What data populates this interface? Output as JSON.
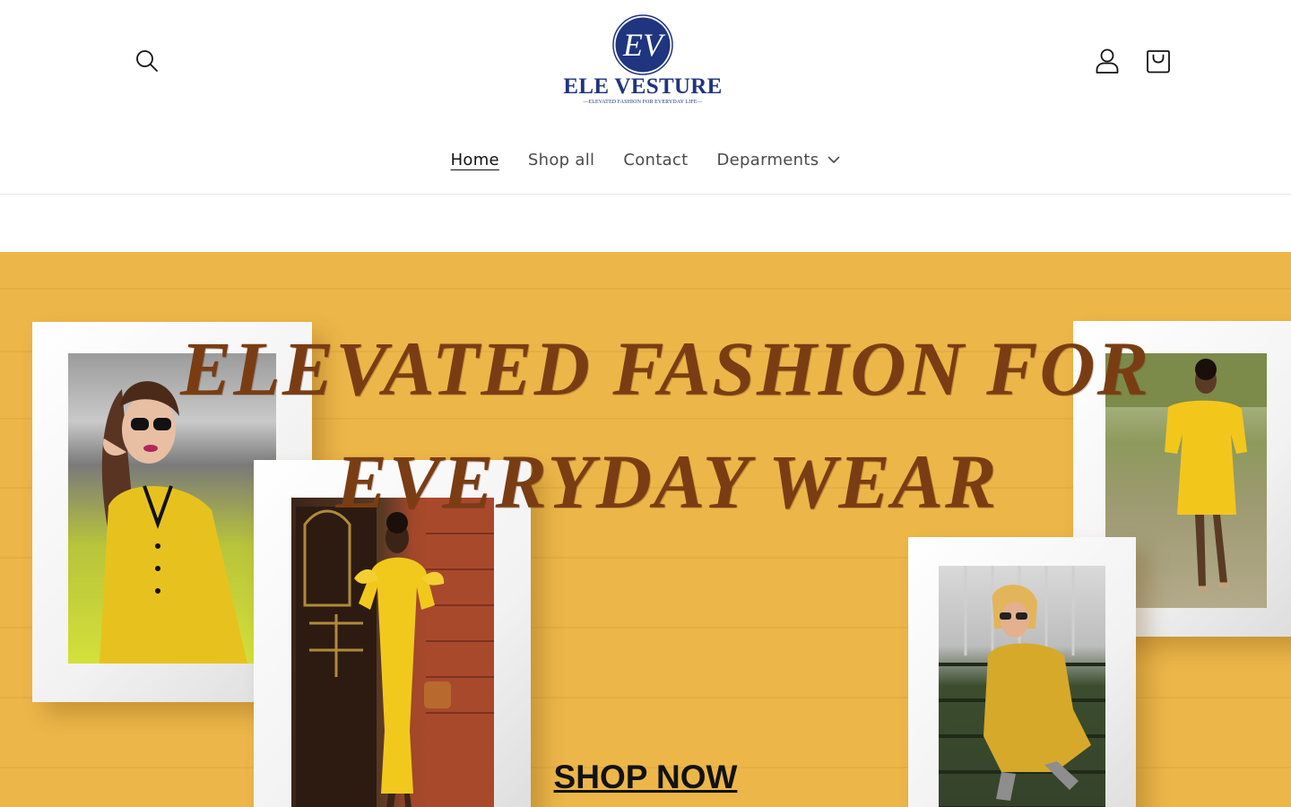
{
  "header": {
    "brand": {
      "monogram": "EV",
      "name": "ELE VESTURE",
      "tagline": "ELEVATED FASHION FOR EVERYDAY LIFE"
    },
    "icons": {
      "search": "search-icon",
      "account": "account-icon",
      "cart": "cart-icon"
    }
  },
  "nav": {
    "items": [
      {
        "label": "Home",
        "active": true
      },
      {
        "label": "Shop all",
        "active": false
      },
      {
        "label": "Contact",
        "active": false
      },
      {
        "label": "Deparments",
        "active": false,
        "has_dropdown": true
      }
    ]
  },
  "hero": {
    "headline_line1": "ELEVATED FASHION FOR",
    "headline_line2": "EVERYDAY WEAR",
    "cta_label": "SHOP NOW",
    "background_color": "#ecb649",
    "headline_color": "#7a3d13"
  },
  "colors": {
    "brand_navy": "#1f3580",
    "text_dark": "#121212",
    "text_nav": "#4a4a4a"
  }
}
